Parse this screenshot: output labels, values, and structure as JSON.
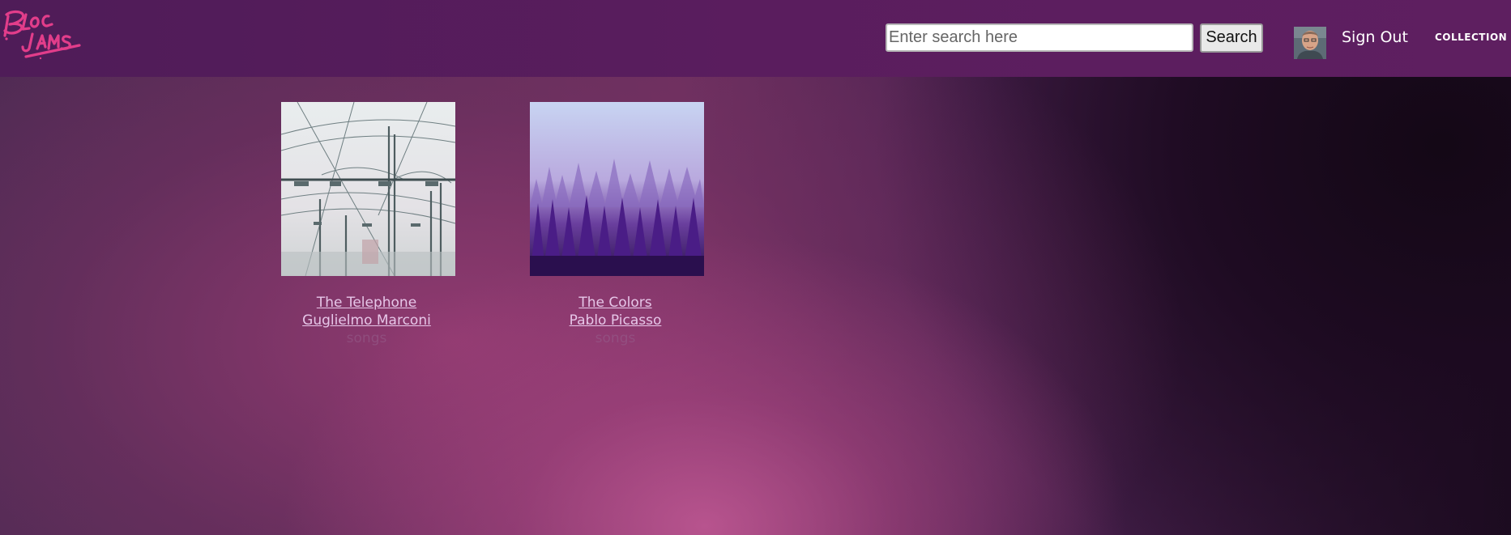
{
  "header": {
    "logo_text": "Bloc Jams",
    "search": {
      "placeholder": "Enter search here",
      "value": "",
      "button_label": "Search"
    },
    "user": {
      "sign_out_label": "Sign Out"
    },
    "nav": {
      "collection_label": "COLLECTION"
    }
  },
  "albums": [
    {
      "title": "The Telephone",
      "artist": "Guglielmo Marconi",
      "songs_label": "songs"
    },
    {
      "title": "The Colors",
      "artist": "Pablo Picasso",
      "songs_label": "songs"
    }
  ],
  "colors": {
    "header_bg": "#5a1d5e",
    "logo_pink": "#e23d8a",
    "link_text": "#e6c6e8"
  }
}
